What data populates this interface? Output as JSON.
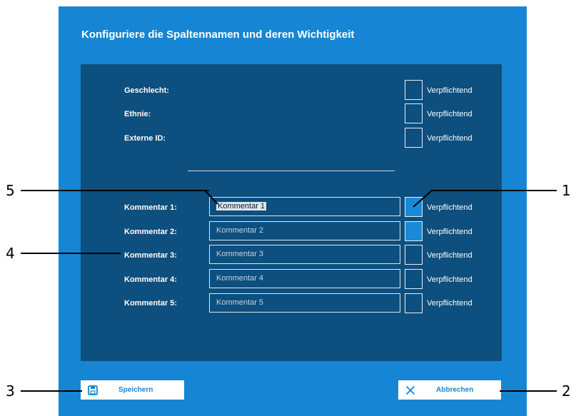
{
  "dialog": {
    "title": "Konfiguriere die Spaltennamen und deren Wichtigkeit",
    "colors": {
      "dialog_bg": "#1686d4",
      "panel_bg": "#0d4f7e",
      "checked": "#1a8ad6"
    }
  },
  "fixed_rows": [
    {
      "label": "Geschlecht:",
      "checkbox_label": "Verpflichtend",
      "checked": false
    },
    {
      "label": "Ethnie:",
      "checkbox_label": "Verpflichtend",
      "checked": false
    },
    {
      "label": "Externe ID:",
      "checkbox_label": "Verpflichtend",
      "checked": false
    }
  ],
  "comment_rows": [
    {
      "label": "Kommentar 1:",
      "value": "Kommentar 1",
      "placeholder": "",
      "checkbox_label": "Verpflichtend",
      "checked": true
    },
    {
      "label": "Kommentar 2:",
      "value": "",
      "placeholder": "Kommentar 2",
      "checkbox_label": "Verpflichtend",
      "checked": true
    },
    {
      "label": "Kommentar 3:",
      "value": "",
      "placeholder": "Kommentar 3",
      "checkbox_label": "Verpflichtend",
      "checked": false
    },
    {
      "label": "Kommentar 4:",
      "value": "",
      "placeholder": "Kommentar 4",
      "checkbox_label": "Verpflichtend",
      "checked": false
    },
    {
      "label": "Kommentar 5:",
      "value": "",
      "placeholder": "Kommentar 5",
      "checkbox_label": "Verpflichtend",
      "checked": false
    }
  ],
  "buttons": {
    "save": {
      "label": "Speichern",
      "icon": "floppy-disk-icon"
    },
    "cancel": {
      "label": "Abbrechen",
      "icon": "close-icon"
    }
  },
  "callouts": [
    "1",
    "2",
    "3",
    "4",
    "5"
  ]
}
